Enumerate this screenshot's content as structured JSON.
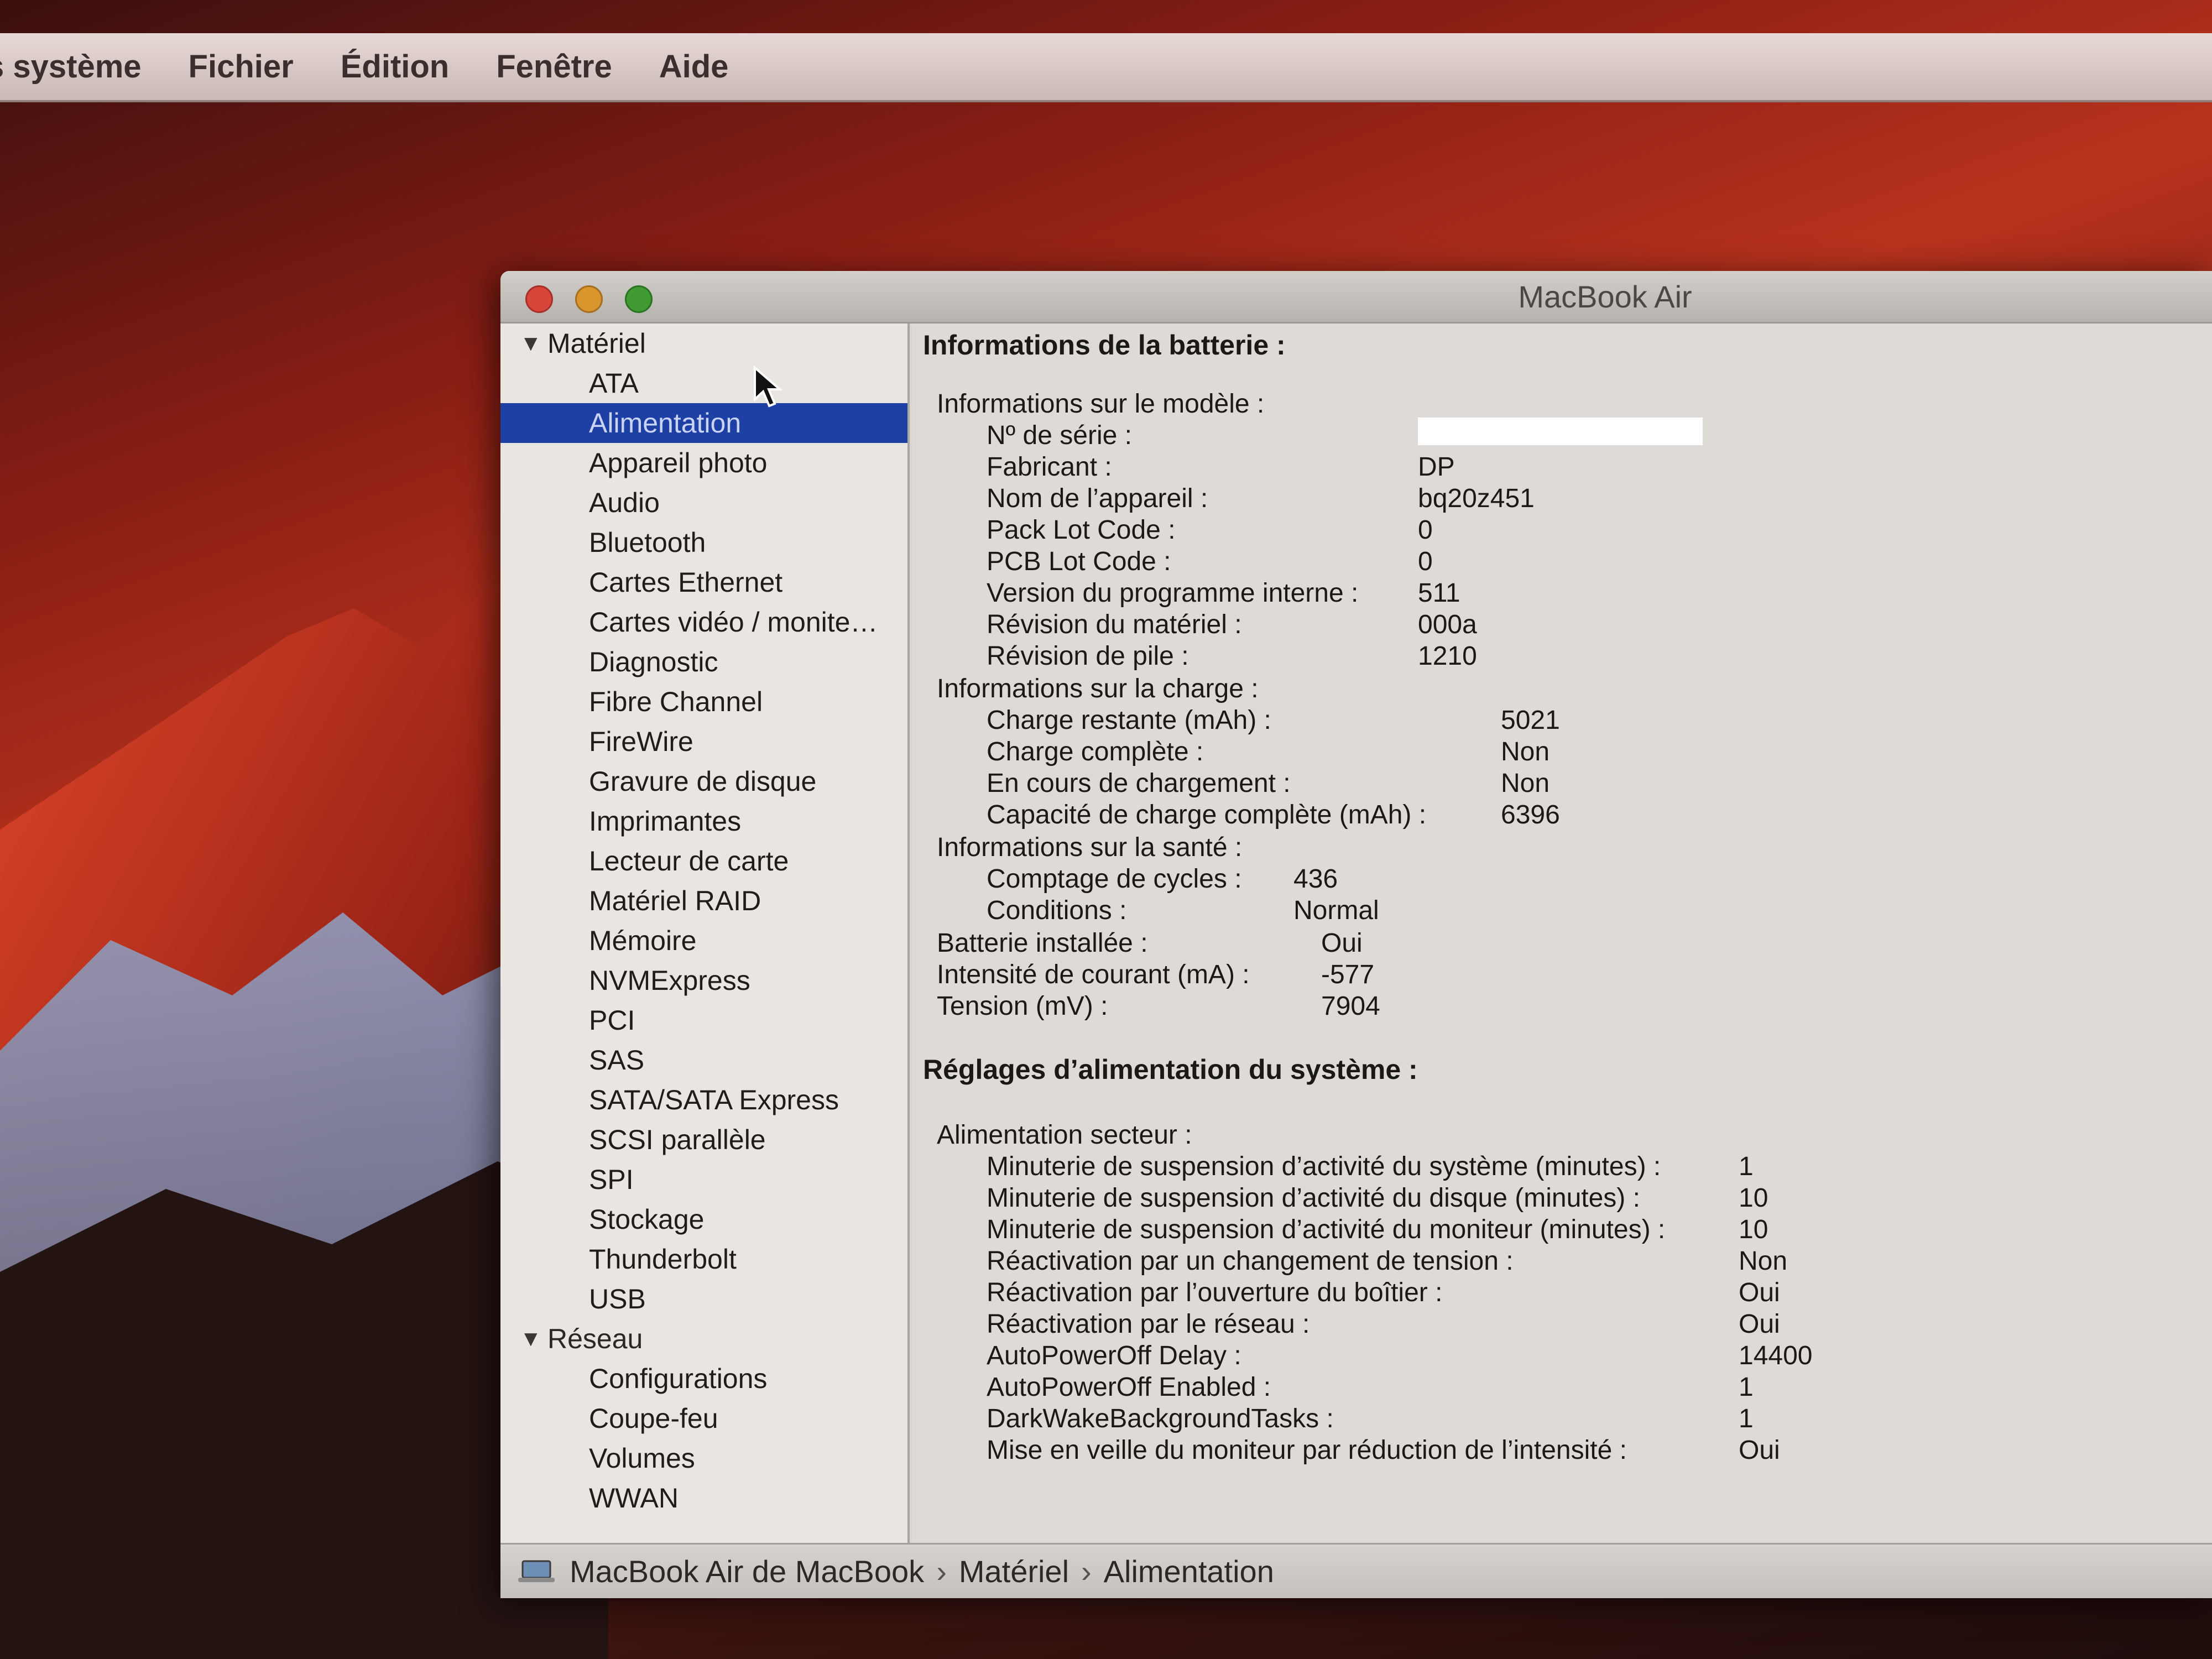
{
  "menubar": {
    "items": [
      "s système",
      "Fichier",
      "Édition",
      "Fenêtre",
      "Aide"
    ]
  },
  "window": {
    "title": "MacBook Air"
  },
  "sidebar": {
    "sections": [
      {
        "label": "Matériel",
        "items": [
          "ATA",
          "Alimentation",
          "Appareil photo",
          "Audio",
          "Bluetooth",
          "Cartes Ethernet",
          "Cartes vidéo / monite…",
          "Diagnostic",
          "Fibre Channel",
          "FireWire",
          "Gravure de disque",
          "Imprimantes",
          "Lecteur de carte",
          "Matériel RAID",
          "Mémoire",
          "NVMExpress",
          "PCI",
          "SAS",
          "SATA/SATA Express",
          "SCSI parallèle",
          "SPI",
          "Stockage",
          "Thunderbolt",
          "USB"
        ]
      },
      {
        "label": "Réseau",
        "items": [
          "Configurations",
          "Coupe-feu",
          "Volumes",
          "WWAN"
        ]
      }
    ],
    "selected": "Alimentation"
  },
  "content": {
    "battery_heading": "Informations de la batterie :",
    "model_group": "Informations sur le modèle :",
    "model": [
      {
        "label": "Nº de série :",
        "value": ""
      },
      {
        "label": "Fabricant :",
        "value": "DP"
      },
      {
        "label": "Nom de l’appareil :",
        "value": "bq20z451"
      },
      {
        "label": "Pack Lot Code :",
        "value": "0"
      },
      {
        "label": "PCB Lot Code :",
        "value": "0"
      },
      {
        "label": "Version du programme interne :",
        "value": "511"
      },
      {
        "label": "Révision du matériel :",
        "value": "000a"
      },
      {
        "label": "Révision de pile :",
        "value": "1210"
      }
    ],
    "charge_group": "Informations sur la charge :",
    "charge": [
      {
        "label": "Charge restante (mAh) :",
        "value": "5021"
      },
      {
        "label": "Charge complète :",
        "value": "Non"
      },
      {
        "label": "En cours de chargement :",
        "value": "Non"
      },
      {
        "label": "Capacité de charge complète (mAh) :",
        "value": "6396"
      }
    ],
    "health_group": "Informations sur la santé :",
    "health": [
      {
        "label": "Comptage de cycles :",
        "value": "436"
      },
      {
        "label": "Conditions :",
        "value": "Normal"
      }
    ],
    "top": [
      {
        "label": "Batterie installée :",
        "value": "Oui"
      },
      {
        "label": "Intensité de courant (mA) :",
        "value": "-577"
      },
      {
        "label": "Tension (mV) :",
        "value": "7904"
      }
    ],
    "power_heading": "Réglages d’alimentation du système :",
    "ac_group": "Alimentation secteur :",
    "ac": [
      {
        "label": "Minuterie de suspension d’activité du système (minutes) :",
        "value": "1"
      },
      {
        "label": "Minuterie de suspension d’activité du disque (minutes) :",
        "value": "10"
      },
      {
        "label": "Minuterie de suspension d’activité du moniteur (minutes) :",
        "value": "10"
      },
      {
        "label": "Réactivation par un changement de tension :",
        "value": "Non"
      },
      {
        "label": "Réactivation par l’ouverture du boîtier :",
        "value": "Oui"
      },
      {
        "label": "Réactivation par le réseau :",
        "value": "Oui"
      },
      {
        "label": "AutoPowerOff Delay :",
        "value": "14400"
      },
      {
        "label": "AutoPowerOff Enabled :",
        "value": "1"
      },
      {
        "label": "DarkWakeBackgroundTasks :",
        "value": "1"
      },
      {
        "label": "Mise en veille du moniteur par réduction de l’intensité :",
        "value": "Oui"
      }
    ]
  },
  "pathbar": {
    "segments": [
      "MacBook Air de MacBook",
      "Matériel",
      "Alimentation"
    ],
    "separator": "›"
  }
}
